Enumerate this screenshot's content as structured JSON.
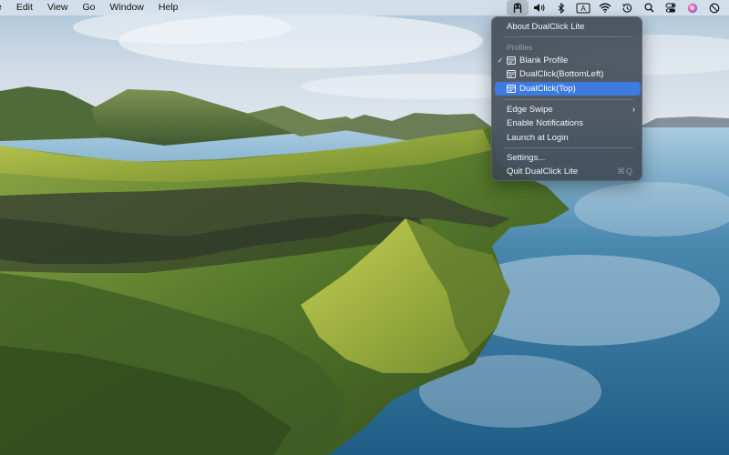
{
  "menubar": {
    "items": [
      "e",
      "Edit",
      "View",
      "Go",
      "Window",
      "Help"
    ],
    "status_icons": [
      "dualclick-icon",
      "volume-icon",
      "bluetooth-icon",
      "input-source-icon",
      "wifi-icon",
      "time-machine-icon",
      "spotlight-search-icon",
      "control-center-icon",
      "siri-icon",
      "do-not-disturb-icon"
    ],
    "input_source_label": "A"
  },
  "dropdown": {
    "about": "About DualClick Lite",
    "profiles_header": "Profiles",
    "profiles": [
      {
        "label": "Blank Profile",
        "checked": true,
        "highlighted": false
      },
      {
        "label": "DualClick(BottomLeft)",
        "checked": false,
        "highlighted": false
      },
      {
        "label": "DualClick(Top)",
        "checked": false,
        "highlighted": true
      }
    ],
    "edge_swipe": "Edge Swipe",
    "enable_notifications": "Enable Notifications",
    "launch_at_login": "Launch at Login",
    "settings": "Settings...",
    "quit": "Quit DualClick Lite",
    "quit_shortcut": "⌘Q",
    "checkmark": "✓",
    "submenu_arrow": "›"
  },
  "colors": {
    "menu_highlight": "#3d7be0",
    "menu_background": "#3a444e"
  }
}
